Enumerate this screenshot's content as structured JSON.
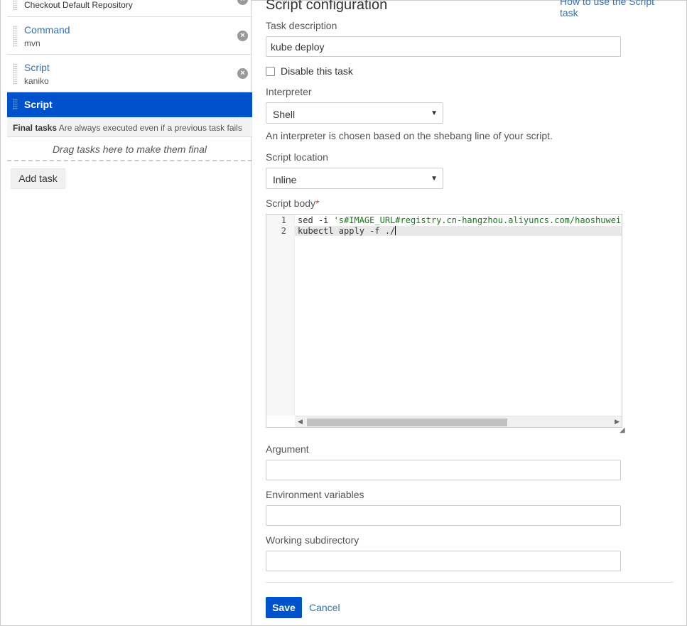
{
  "sidebar": {
    "tasks": [
      {
        "name": "Checkout Default Repository",
        "sub": ""
      },
      {
        "name": "Command",
        "sub": "mvn"
      },
      {
        "name": "Script",
        "sub": "kaniko"
      },
      {
        "name": "Script",
        "sub": ""
      }
    ],
    "final_tasks_title": "Final tasks",
    "final_tasks_desc": "Are always executed even if a previous task fails",
    "drop_hint": "Drag tasks here to make them final",
    "add_task_label": "Add task"
  },
  "main": {
    "title": "Script configuration",
    "help_link": "How to use the Script task",
    "task_description_label": "Task description",
    "task_description_value": "kube deploy",
    "disable_label": "Disable this task",
    "interpreter_label": "Interpreter",
    "interpreter_value": "Shell",
    "interpreter_hint": "An interpreter is chosen based on the shebang line of your script.",
    "script_location_label": "Script location",
    "script_location_value": "Inline",
    "script_body_label": "Script body",
    "script_body_required": "*",
    "script_lines": [
      {
        "num": "1",
        "cmd": "sed -i ",
        "str": "'s#IMAGE_URL#registry.cn-hangzhou.aliyuncs.com/haoshuwei/b"
      },
      {
        "num": "2",
        "cmd": "kubectl apply -f ./",
        "str": ""
      }
    ],
    "argument_label": "Argument",
    "env_label": "Environment variables",
    "workdir_label": "Working subdirectory",
    "save_label": "Save",
    "cancel_label": "Cancel"
  },
  "colors": {
    "accent": "#0052cc",
    "link": "#3572b0"
  }
}
